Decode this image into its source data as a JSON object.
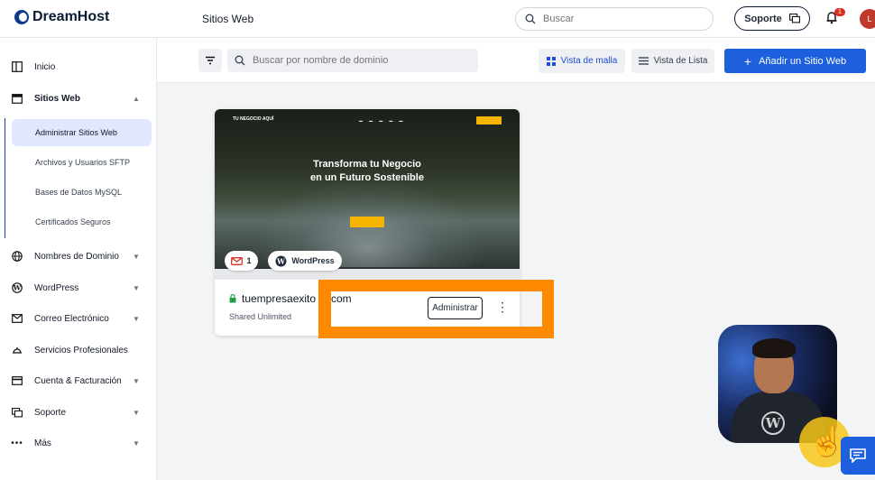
{
  "header": {
    "brand": "DreamHost",
    "page_title": "Sitios Web",
    "search_placeholder": "Buscar",
    "support_label": "Soporte",
    "notification_count": "1",
    "user_initial": "L"
  },
  "sidebar": {
    "items": [
      {
        "label": "Inicio",
        "icon": "dashboard-icon"
      },
      {
        "label": "Sitios Web",
        "icon": "websites-icon",
        "expanded": true
      },
      {
        "label": "Nombres de Dominio",
        "icon": "globe-icon"
      },
      {
        "label": "WordPress",
        "icon": "wordpress-icon"
      },
      {
        "label": "Correo Electrónico",
        "icon": "mail-icon"
      },
      {
        "label": "Servicios Profesionales",
        "icon": "services-icon"
      },
      {
        "label": "Cuenta & Facturación",
        "icon": "billing-icon"
      },
      {
        "label": "Soporte",
        "icon": "support-icon"
      },
      {
        "label": "Más",
        "icon": "more-icon"
      }
    ],
    "sub_items": [
      {
        "label": "Administrar Sitios Web",
        "active": true
      },
      {
        "label": "Archivos y Usuarios SFTP"
      },
      {
        "label": "Bases de Datos MySQL"
      },
      {
        "label": "Certificados Seguros"
      }
    ]
  },
  "toolbar": {
    "domain_search_placeholder": "Buscar por nombre de dominio",
    "grid_view_label": "Vista de malla",
    "list_view_label": "Vista de Lista",
    "add_site_label": "Añadir un Sitio Web"
  },
  "site_card": {
    "preview": {
      "brand": "TU NEGOCIO AQUÍ",
      "hero_line1": "Transforma tu Negocio",
      "hero_line2": "en un Futuro Sostenible"
    },
    "mail_count": "1",
    "platform": "WordPress",
    "domain": "tuempresaexito",
    "domain_suffix": "com",
    "plan": "Shared Unlimited",
    "manage_label": "Administrar"
  },
  "colors": {
    "accent": "#1d5fdc",
    "highlight": "#ff8a00",
    "active_nav": "#e0e7ff"
  }
}
